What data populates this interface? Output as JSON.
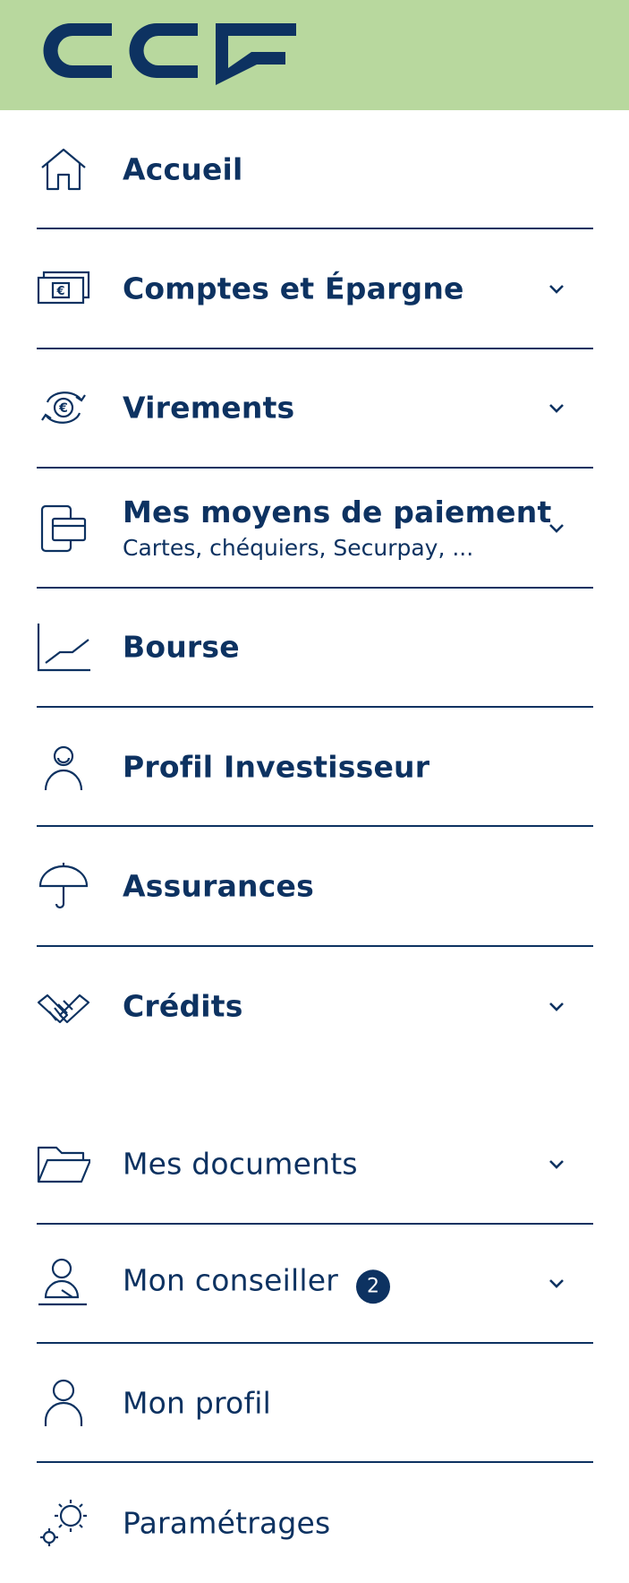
{
  "brand": {
    "name": "CCF",
    "color": "#0d3261",
    "header_bg": "#b8d89e"
  },
  "menu": {
    "accueil": {
      "label": "Accueil",
      "icon": "home-icon"
    },
    "comptes": {
      "label": "Comptes et Épargne",
      "icon": "banknote-euro-icon"
    },
    "virements": {
      "label": "Virements",
      "icon": "euro-exchange-icon"
    },
    "paiement": {
      "label": "Mes moyens de paiement",
      "sublabel": "Cartes, chéquiers, Securpay, ...",
      "icon": "card-phone-icon"
    },
    "bourse": {
      "label": "Bourse",
      "icon": "line-chart-icon"
    },
    "profil_investisseur": {
      "label": "Profil Investisseur",
      "icon": "investor-person-icon"
    },
    "assurances": {
      "label": "Assurances",
      "icon": "umbrella-icon"
    },
    "credits": {
      "label": "Crédits",
      "icon": "handshake-icon"
    }
  },
  "secondary": {
    "documents": {
      "label": "Mes documents",
      "icon": "folder-icon"
    },
    "conseiller": {
      "label": "Mon conseiller",
      "badge": "2",
      "icon": "advisor-icon"
    },
    "profil": {
      "label": "Mon profil",
      "icon": "user-icon"
    },
    "parametrages": {
      "label": "Paramétrages",
      "icon": "gears-icon"
    }
  }
}
